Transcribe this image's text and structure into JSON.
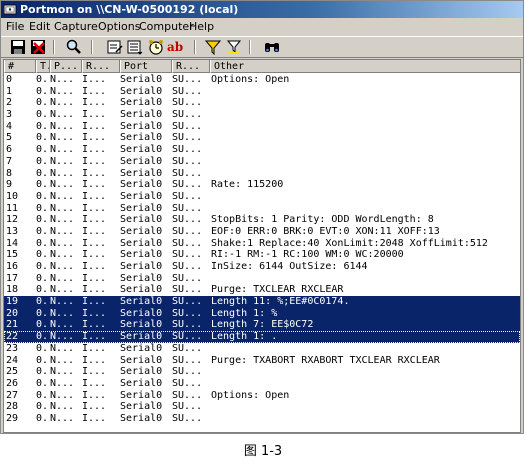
{
  "window": {
    "title": "Portmon on \\\\CN-W-0500192 (local)"
  },
  "menu": [
    "File",
    "Edit",
    "Capture",
    "Options",
    "Computer",
    "Help"
  ],
  "toolbar": {
    "icons": [
      "save-icon",
      "clear-log-icon",
      "find-icon",
      "capture-icon",
      "autoscroll-icon",
      "clock-icon",
      "ab-icon",
      "filter-icon",
      "highlight-icon",
      "binoculars-icon"
    ],
    "ab_label": "ab"
  },
  "columns": [
    "#",
    "T.",
    "P...",
    "R...",
    "Port",
    "R...",
    "Other"
  ],
  "rows": [
    {
      "n": "0",
      "t": "0..",
      "p": "N...",
      "r": "I...",
      "port": "Serial0",
      "res": "SU...",
      "other": "Options: Open"
    },
    {
      "n": "1",
      "t": "0..",
      "p": "N...",
      "r": "I...",
      "port": "Serial0",
      "res": "SU...",
      "other": ""
    },
    {
      "n": "2",
      "t": "0..",
      "p": "N...",
      "r": "I...",
      "port": "Serial0",
      "res": "SU...",
      "other": ""
    },
    {
      "n": "3",
      "t": "0..",
      "p": "N...",
      "r": "I...",
      "port": "Serial0",
      "res": "SU...",
      "other": ""
    },
    {
      "n": "4",
      "t": "0..",
      "p": "N...",
      "r": "I...",
      "port": "Serial0",
      "res": "SU...",
      "other": ""
    },
    {
      "n": "5",
      "t": "0..",
      "p": "N...",
      "r": "I...",
      "port": "Serial0",
      "res": "SU...",
      "other": ""
    },
    {
      "n": "6",
      "t": "0..",
      "p": "N...",
      "r": "I...",
      "port": "Serial0",
      "res": "SU...",
      "other": ""
    },
    {
      "n": "7",
      "t": "0..",
      "p": "N...",
      "r": "I...",
      "port": "Serial0",
      "res": "SU...",
      "other": ""
    },
    {
      "n": "8",
      "t": "0..",
      "p": "N...",
      "r": "I...",
      "port": "Serial0",
      "res": "SU...",
      "other": ""
    },
    {
      "n": "9",
      "t": "0..",
      "p": "N...",
      "r": "I...",
      "port": "Serial0",
      "res": "SU...",
      "other": "Rate: 115200"
    },
    {
      "n": "10",
      "t": "0..",
      "p": "N...",
      "r": "I...",
      "port": "Serial0",
      "res": "SU...",
      "other": ""
    },
    {
      "n": "11",
      "t": "0..",
      "p": "N...",
      "r": "I...",
      "port": "Serial0",
      "res": "SU...",
      "other": ""
    },
    {
      "n": "12",
      "t": "0..",
      "p": "N...",
      "r": "I...",
      "port": "Serial0",
      "res": "SU...",
      "other": "StopBits: 1 Parity: ODD WordLength: 8"
    },
    {
      "n": "13",
      "t": "0..",
      "p": "N...",
      "r": "I...",
      "port": "Serial0",
      "res": "SU...",
      "other": "EOF:0 ERR:0 BRK:0 EVT:0 XON:11 XOFF:13"
    },
    {
      "n": "14",
      "t": "0..",
      "p": "N...",
      "r": "I...",
      "port": "Serial0",
      "res": "SU...",
      "other": "Shake:1 Replace:40 XonLimit:2048 XoffLimit:512"
    },
    {
      "n": "15",
      "t": "0..",
      "p": "N...",
      "r": "I...",
      "port": "Serial0",
      "res": "SU...",
      "other": "RI:-1 RM:-1 RC:100 WM:0 WC:20000"
    },
    {
      "n": "16",
      "t": "0..",
      "p": "N...",
      "r": "I...",
      "port": "Serial0",
      "res": "SU...",
      "other": "InSize: 6144 OutSize: 6144"
    },
    {
      "n": "17",
      "t": "0..",
      "p": "N...",
      "r": "I...",
      "port": "Serial0",
      "res": "SU...",
      "other": ""
    },
    {
      "n": "18",
      "t": "0..",
      "p": "N...",
      "r": "I...",
      "port": "Serial0",
      "res": "SU...",
      "other": "Purge: TXCLEAR RXCLEAR"
    },
    {
      "n": "19",
      "t": "0..",
      "p": "N...",
      "r": "I...",
      "port": "Serial0",
      "res": "SU...",
      "other": "Length 11: %;EE#0C0174.",
      "selected": true
    },
    {
      "n": "20",
      "t": "0..",
      "p": "N...",
      "r": "I...",
      "port": "Serial0",
      "res": "SU...",
      "other": "Length 1: %",
      "selected": true
    },
    {
      "n": "21",
      "t": "0..",
      "p": "N...",
      "r": "I...",
      "port": "Serial0",
      "res": "SU...",
      "other": "Length 7: EE$0C72",
      "selected": true
    },
    {
      "n": "22",
      "t": "0..",
      "p": "N...",
      "r": "I...",
      "port": "Serial0",
      "res": "SU...",
      "other": "Length 1: .",
      "selected": true,
      "focused": true
    },
    {
      "n": "23",
      "t": "0..",
      "p": "N...",
      "r": "I...",
      "port": "Serial0",
      "res": "SU...",
      "other": ""
    },
    {
      "n": "24",
      "t": "0..",
      "p": "N...",
      "r": "I...",
      "port": "Serial0",
      "res": "SU...",
      "other": "Purge: TXABORT RXABORT TXCLEAR RXCLEAR"
    },
    {
      "n": "25",
      "t": "0..",
      "p": "N...",
      "r": "I...",
      "port": "Serial0",
      "res": "SU...",
      "other": ""
    },
    {
      "n": "26",
      "t": "0..",
      "p": "N...",
      "r": "I...",
      "port": "Serial0",
      "res": "SU...",
      "other": ""
    },
    {
      "n": "27",
      "t": "0..",
      "p": "N...",
      "r": "I...",
      "port": "Serial0",
      "res": "SU...",
      "other": "Options: Open"
    },
    {
      "n": "28",
      "t": "0..",
      "p": "N...",
      "r": "I...",
      "port": "Serial0",
      "res": "SU...",
      "other": ""
    },
    {
      "n": "29",
      "t": "0..",
      "p": "N...",
      "r": "I...",
      "port": "Serial0",
      "res": "SU...",
      "other": ""
    }
  ],
  "caption": "图 1-3",
  "colors": {
    "selection": "#0a246a",
    "titlebar": "#0a246a",
    "chrome": "#d4d0c8"
  }
}
